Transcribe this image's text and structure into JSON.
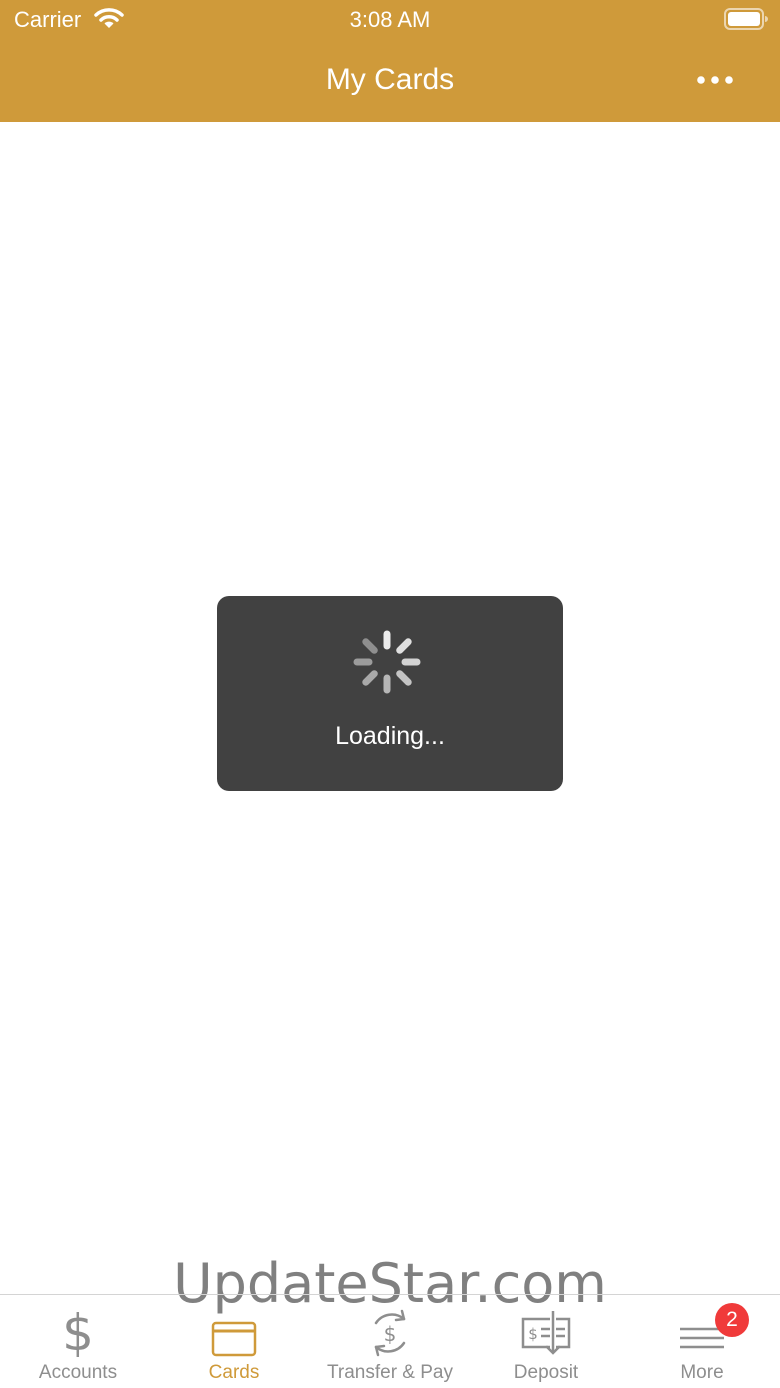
{
  "status_bar": {
    "carrier": "Carrier",
    "time": "3:08 AM"
  },
  "header": {
    "title": "My Cards",
    "background_color": "#CF9A3A"
  },
  "loading": {
    "text": "Loading..."
  },
  "watermark": {
    "text": "UpdateStar.com"
  },
  "tab_bar": {
    "active_color": "#CF9A3A",
    "inactive_color": "#8E8E8E",
    "tabs": [
      {
        "label": "Accounts",
        "icon": "dollar-icon",
        "active": false
      },
      {
        "label": "Cards",
        "icon": "card-icon",
        "active": true
      },
      {
        "label": "Transfer & Pay",
        "icon": "transfer-icon",
        "active": false
      },
      {
        "label": "Deposit",
        "icon": "check-deposit-icon",
        "active": false
      },
      {
        "label": "More",
        "icon": "menu-icon",
        "active": false,
        "badge": "2"
      }
    ]
  }
}
